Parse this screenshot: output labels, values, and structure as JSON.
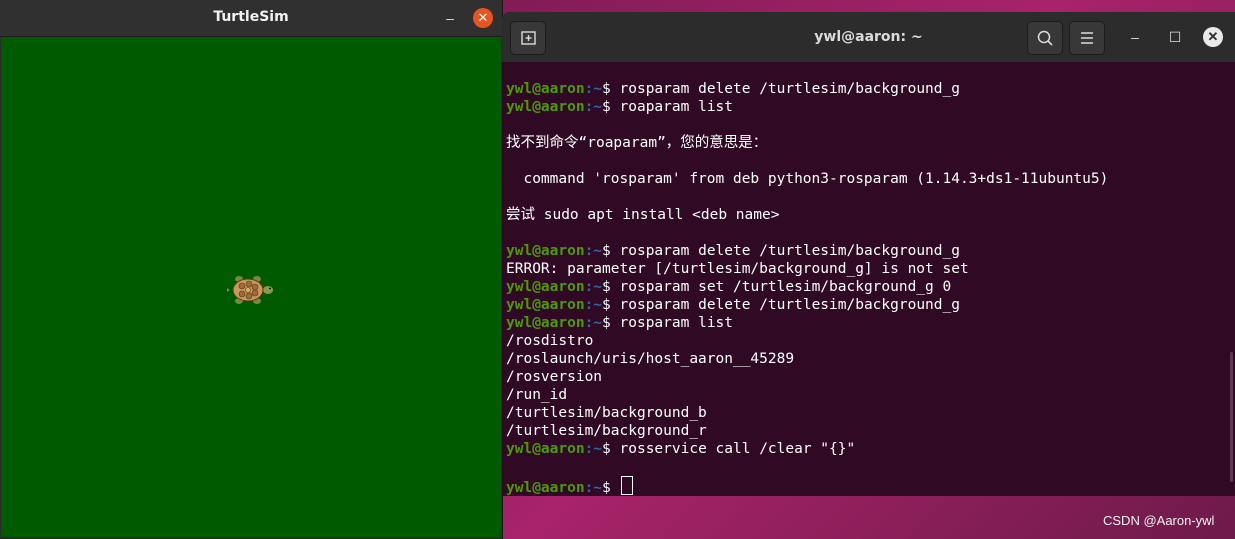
{
  "turtlesim": {
    "title": "TurtleSim",
    "minimize_glyph": "–",
    "close_glyph": "✕",
    "background_color": "#005a00"
  },
  "terminal": {
    "title": "ywl@aaron: ~",
    "prompt_user": "ywl@aaron",
    "prompt_path": ":~",
    "prompt_symbol": "$ ",
    "lines": [
      {
        "type": "cmd",
        "text": "rosparam delete /turtlesim/background_g"
      },
      {
        "type": "cmd",
        "text": "roaparam list"
      },
      {
        "type": "out",
        "text": ""
      },
      {
        "type": "out",
        "text": "找不到命令“roaparam”，您的意思是："
      },
      {
        "type": "out",
        "text": ""
      },
      {
        "type": "out",
        "text": "  command 'rosparam' from deb python3-rosparam (1.14.3+ds1-11ubuntu5)"
      },
      {
        "type": "out",
        "text": ""
      },
      {
        "type": "out",
        "text": "尝试 sudo apt install <deb name>"
      },
      {
        "type": "out",
        "text": ""
      },
      {
        "type": "cmd",
        "text": "rosparam delete /turtlesim/background_g"
      },
      {
        "type": "out",
        "text": "ERROR: parameter [/turtlesim/background_g] is not set"
      },
      {
        "type": "cmd",
        "text": "rosparam set /turtlesim/background_g 0"
      },
      {
        "type": "cmd",
        "text": "rosparam delete /turtlesim/background_g"
      },
      {
        "type": "cmd",
        "text": "rosparam list"
      },
      {
        "type": "out",
        "text": "/rosdistro"
      },
      {
        "type": "out",
        "text": "/roslaunch/uris/host_aaron__45289"
      },
      {
        "type": "out",
        "text": "/rosversion"
      },
      {
        "type": "out",
        "text": "/run_id"
      },
      {
        "type": "out",
        "text": "/turtlesim/background_b"
      },
      {
        "type": "out",
        "text": "/turtlesim/background_r"
      },
      {
        "type": "cmd",
        "text": "rosservice call /clear \"{}\""
      },
      {
        "type": "out",
        "text": ""
      },
      {
        "type": "cursor",
        "text": ""
      }
    ],
    "window_controls": {
      "minimize": "–",
      "maximize": "☐",
      "close": "✕"
    }
  },
  "watermark": "CSDN @Aaron-ywl",
  "colors": {
    "prompt_user": "#4e9a06",
    "prompt_path": "#3465a4",
    "terminal_bg": "#300a24",
    "close_button": "#e95420"
  }
}
